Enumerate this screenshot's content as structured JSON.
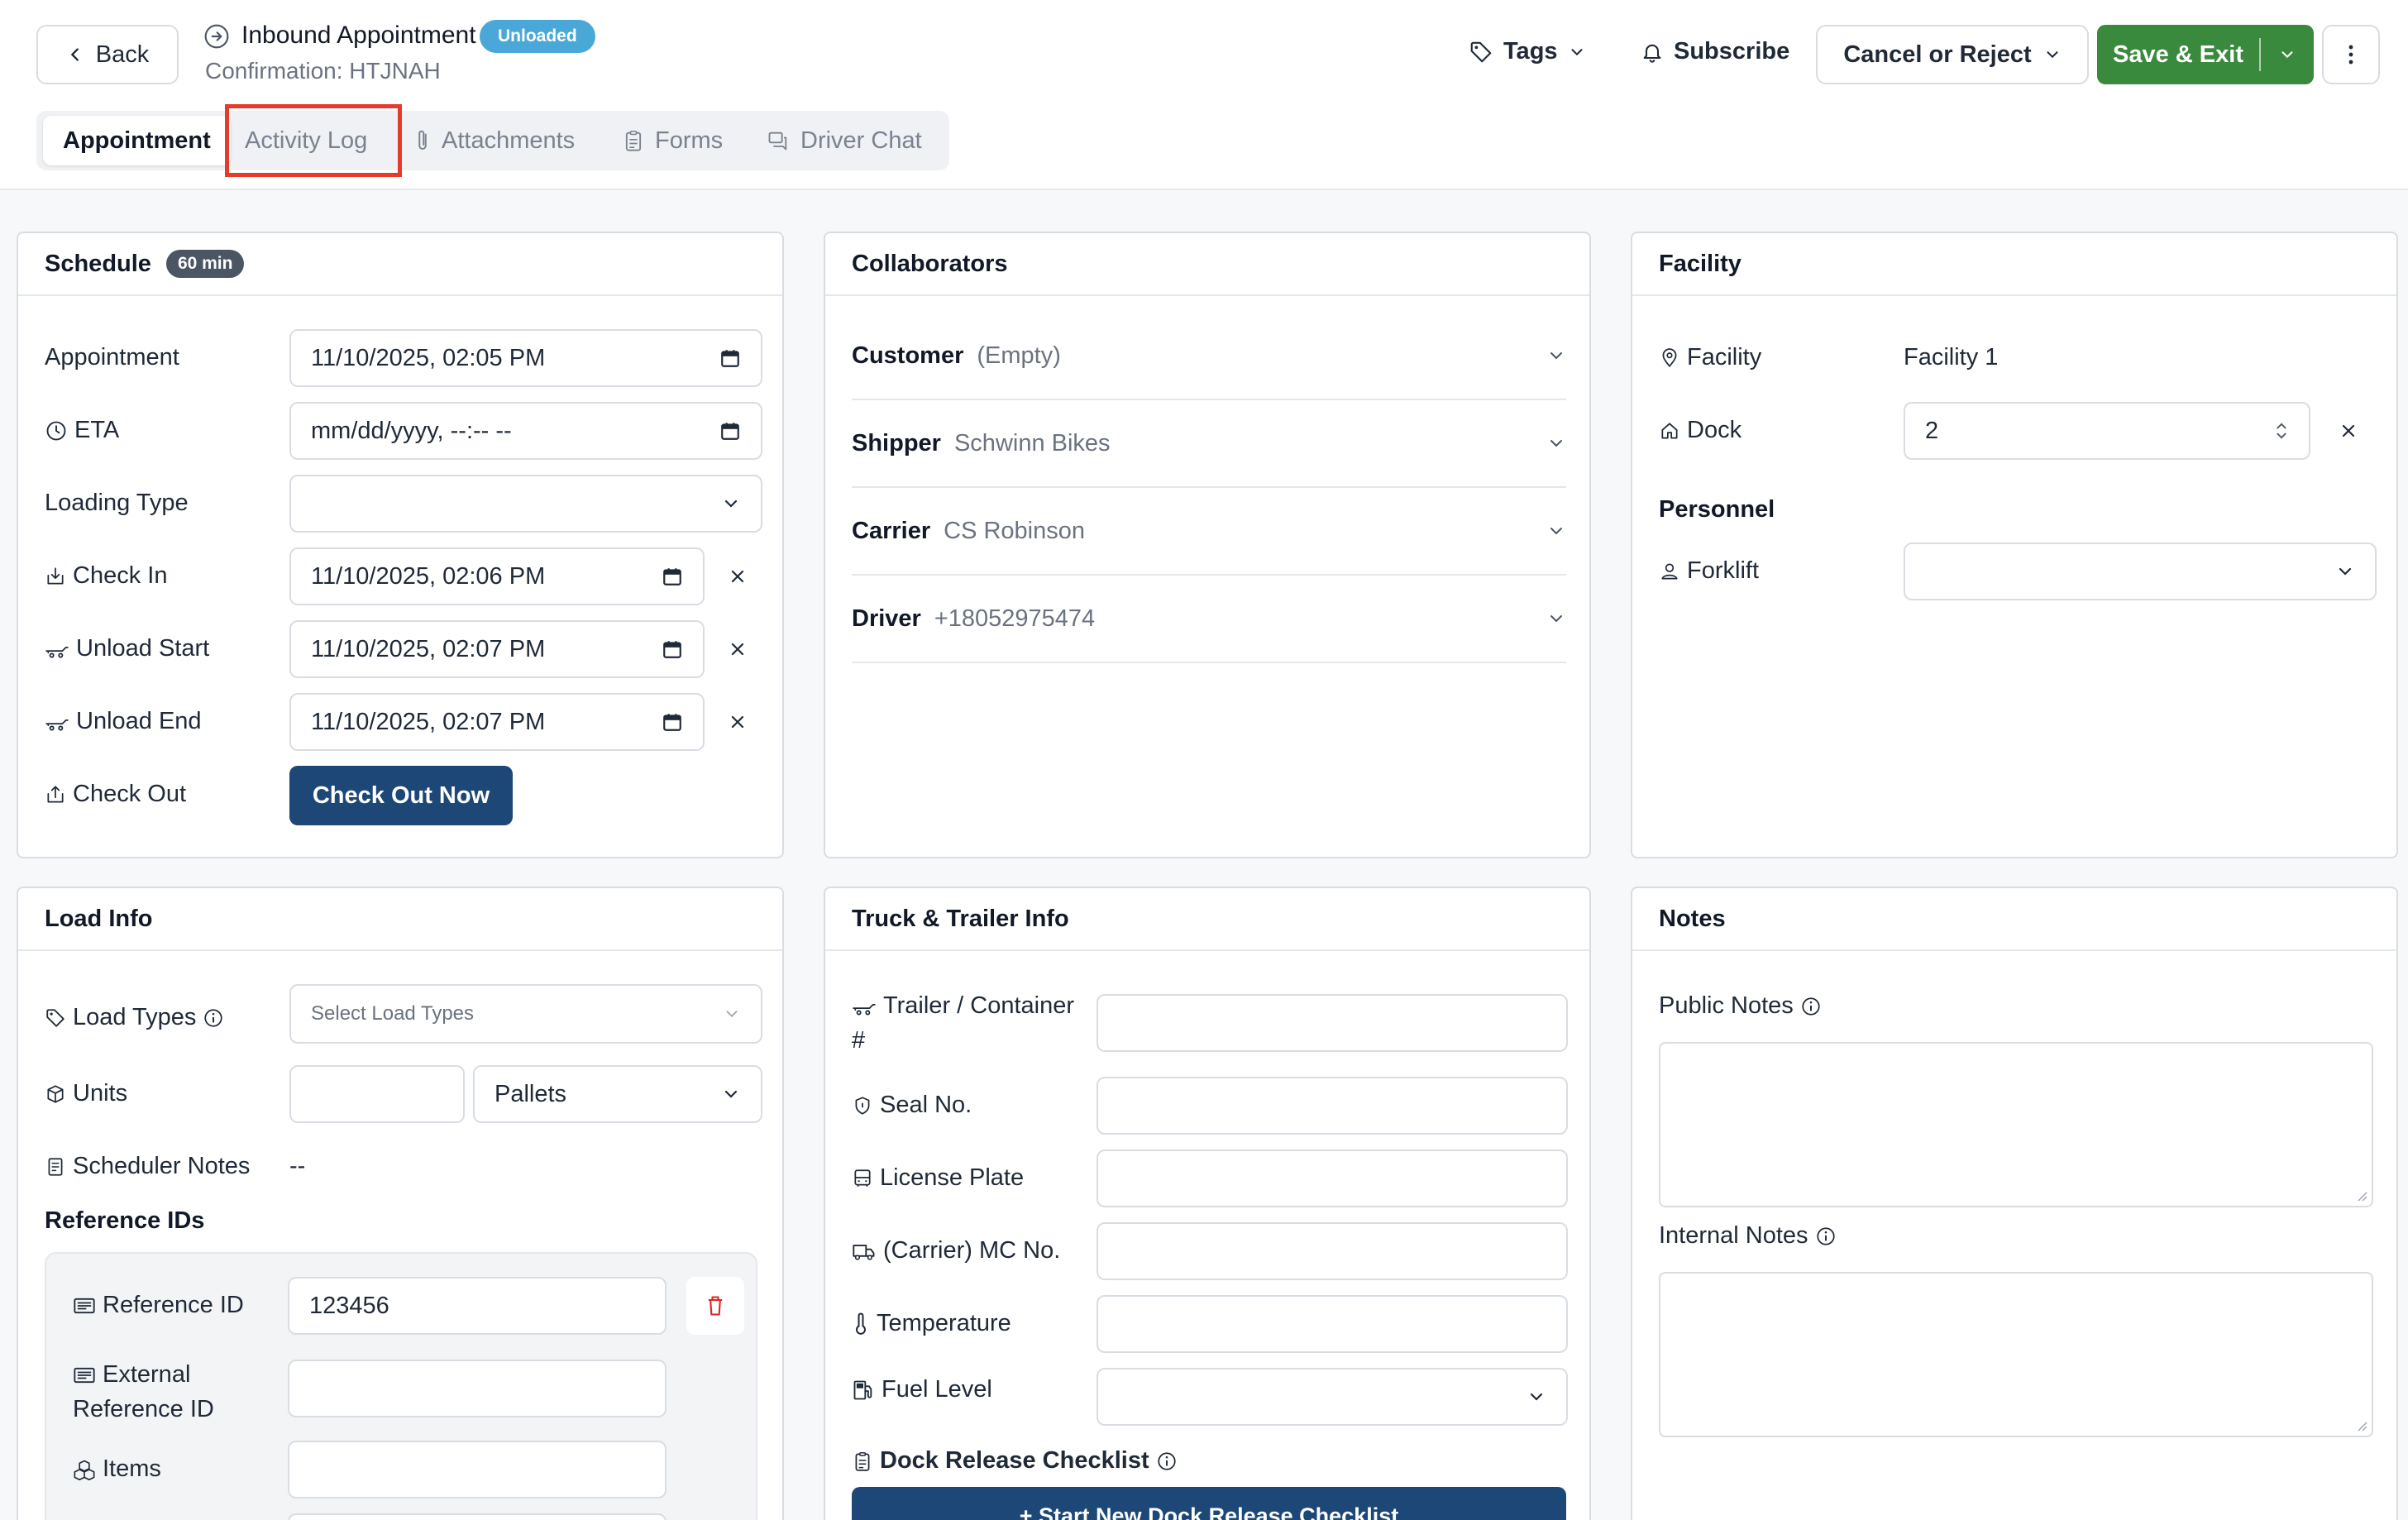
{
  "header": {
    "back_label": "Back",
    "title": "Inbound Appointment",
    "status_badge": "Unloaded",
    "confirmation": "Confirmation: HTJNAH",
    "tags_label": "Tags",
    "subscribe_label": "Subscribe",
    "cancel_label": "Cancel or Reject",
    "save_label": "Save & Exit"
  },
  "tabs": [
    {
      "label": "Appointment",
      "active": true
    },
    {
      "label": "Activity Log",
      "active": false
    },
    {
      "label": "Attachments",
      "active": false
    },
    {
      "label": "Forms",
      "active": false
    },
    {
      "label": "Driver Chat",
      "active": false
    }
  ],
  "schedule": {
    "title": "Schedule",
    "duration": "60 min",
    "appointment_label": "Appointment",
    "appointment_value": "11/10/2025, 02:05  PM",
    "eta_label": "ETA",
    "eta_value": "mm/dd/yyyy, --:-- --",
    "loading_type_label": "Loading Type",
    "loading_type_value": "",
    "check_in_label": "Check In",
    "check_in_value": "11/10/2025, 02:06  PM",
    "unload_start_label": "Unload Start",
    "unload_start_value": "11/10/2025, 02:07  PM",
    "unload_end_label": "Unload End",
    "unload_end_value": "11/10/2025, 02:07  PM",
    "check_out_label": "Check Out",
    "check_out_button": "Check Out Now"
  },
  "collaborators": {
    "title": "Collaborators",
    "rows": [
      {
        "label": "Customer",
        "value": "(Empty)"
      },
      {
        "label": "Shipper",
        "value": "Schwinn Bikes"
      },
      {
        "label": "Carrier",
        "value": "CS Robinson"
      },
      {
        "label": "Driver",
        "value": "+18052975474"
      }
    ]
  },
  "facility": {
    "title": "Facility",
    "facility_label": "Facility",
    "facility_value": "Facility 1",
    "dock_label": "Dock",
    "dock_value": "2",
    "personnel_label": "Personnel",
    "forklift_label": "Forklift",
    "forklift_value": ""
  },
  "load_info": {
    "title": "Load Info",
    "load_types_label": "Load Types",
    "load_types_placeholder": "Select Load Types",
    "units_label": "Units",
    "units_value": "",
    "units_type": "Pallets",
    "scheduler_notes_label": "Scheduler Notes",
    "scheduler_notes_value": "--",
    "reference_ids_label": "Reference IDs",
    "reference_id_label": "Reference ID",
    "reference_id_value": "123456",
    "external_ref_label_1": "External",
    "external_ref_label_2": "Reference ID",
    "external_ref_value": "",
    "items_label": "Items",
    "items_value": ""
  },
  "truck": {
    "title": "Truck & Trailer Info",
    "trailer_label_1": "Trailer / Container",
    "trailer_label_2": "#",
    "seal_label": "Seal No.",
    "plate_label": "License Plate",
    "mc_label": "(Carrier) MC No.",
    "temp_label": "Temperature",
    "fuel_label": "Fuel Level",
    "checklist_label": "Dock Release Checklist",
    "checklist_button": "+  Start New Dock Release Checklist"
  },
  "notes": {
    "title": "Notes",
    "public_label": "Public Notes",
    "internal_label": "Internal Notes"
  },
  "colors": {
    "primary": "#1d4777",
    "save_green": "#3a8a3e",
    "badge_blue": "#4aa8d8",
    "highlight_red": "#e53b2c"
  }
}
